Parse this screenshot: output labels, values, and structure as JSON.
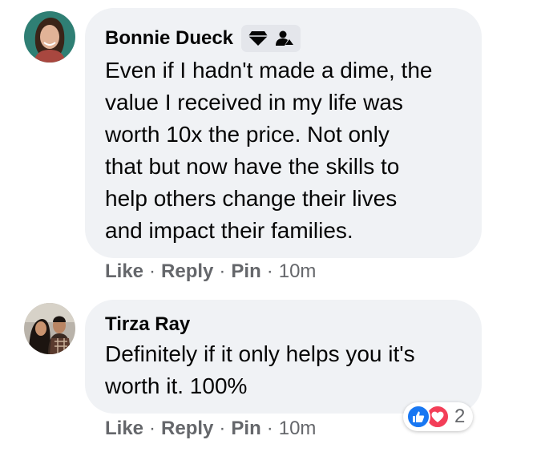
{
  "comments": [
    {
      "author": "Bonnie Dueck",
      "badges": [
        "diamond-icon",
        "person-share-icon"
      ],
      "text_lines": [
        "Even if I hadn't made a dime, the",
        "value I received in my life was",
        "worth 10x the price. Not only",
        "that but now have the skills to",
        "help others change their lives",
        "and impact their families."
      ],
      "actions": {
        "like": "Like",
        "reply": "Reply",
        "pin": "Pin",
        "time": "10m"
      }
    },
    {
      "author": "Tirza Ray",
      "text_lines": [
        "Definitely if it only helps you it's",
        "worth it. 100%"
      ],
      "actions": {
        "like": "Like",
        "reply": "Reply",
        "pin": "Pin",
        "time": "10m"
      },
      "reactions": {
        "types": [
          "like-icon",
          "love-icon"
        ],
        "count": "2"
      }
    }
  ],
  "colors": {
    "bubble": "#f0f2f5",
    "secondary_text": "#65676b",
    "like_blue": "#1877f2",
    "love_red": "#f33e58"
  }
}
